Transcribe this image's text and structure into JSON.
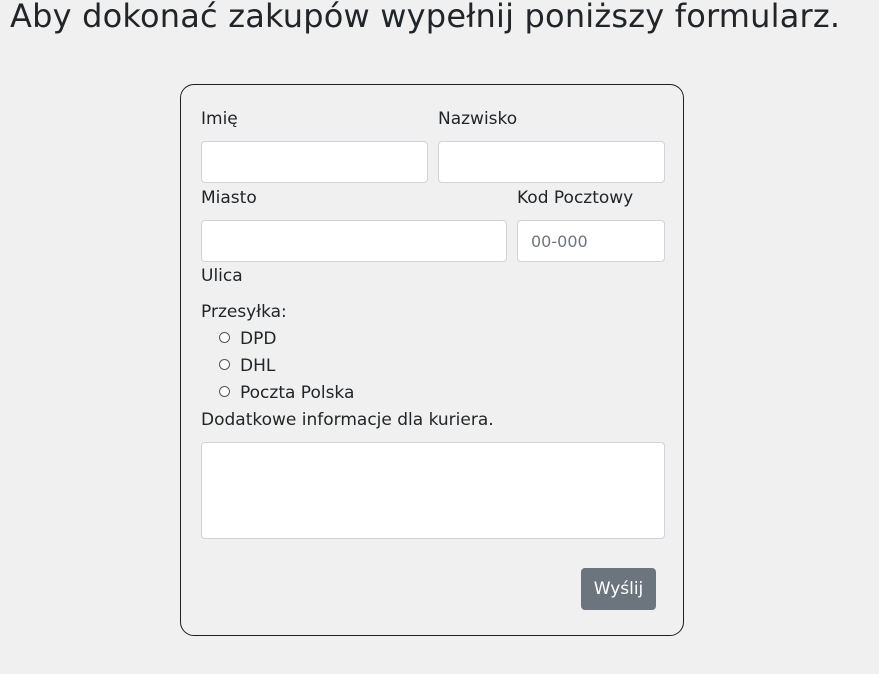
{
  "page": {
    "title": "Aby dokonać zakupów wypełnij poniższy formularz."
  },
  "form": {
    "first_name": {
      "label": "Imię",
      "value": "",
      "placeholder": ""
    },
    "last_name": {
      "label": "Nazwisko",
      "value": "",
      "placeholder": ""
    },
    "city": {
      "label": "Miasto",
      "value": "",
      "placeholder": ""
    },
    "postal_code": {
      "label": "Kod Pocztowy",
      "value": "",
      "placeholder": "00-000"
    },
    "street": {
      "label": "Ulica"
    },
    "shipping": {
      "label": "Przesyłka:",
      "options": [
        {
          "label": "DPD",
          "selected": false
        },
        {
          "label": "DHL",
          "selected": false
        },
        {
          "label": "Poczta Polska",
          "selected": false
        }
      ]
    },
    "notes": {
      "label": "Dodatkowe informacje dla kuriera.",
      "value": ""
    },
    "submit_label": "Wyślij"
  },
  "colors": {
    "background": "#f0f0f0",
    "button": "#6c757d",
    "input_border": "#ced4da",
    "card_border": "#1f1f1f"
  }
}
